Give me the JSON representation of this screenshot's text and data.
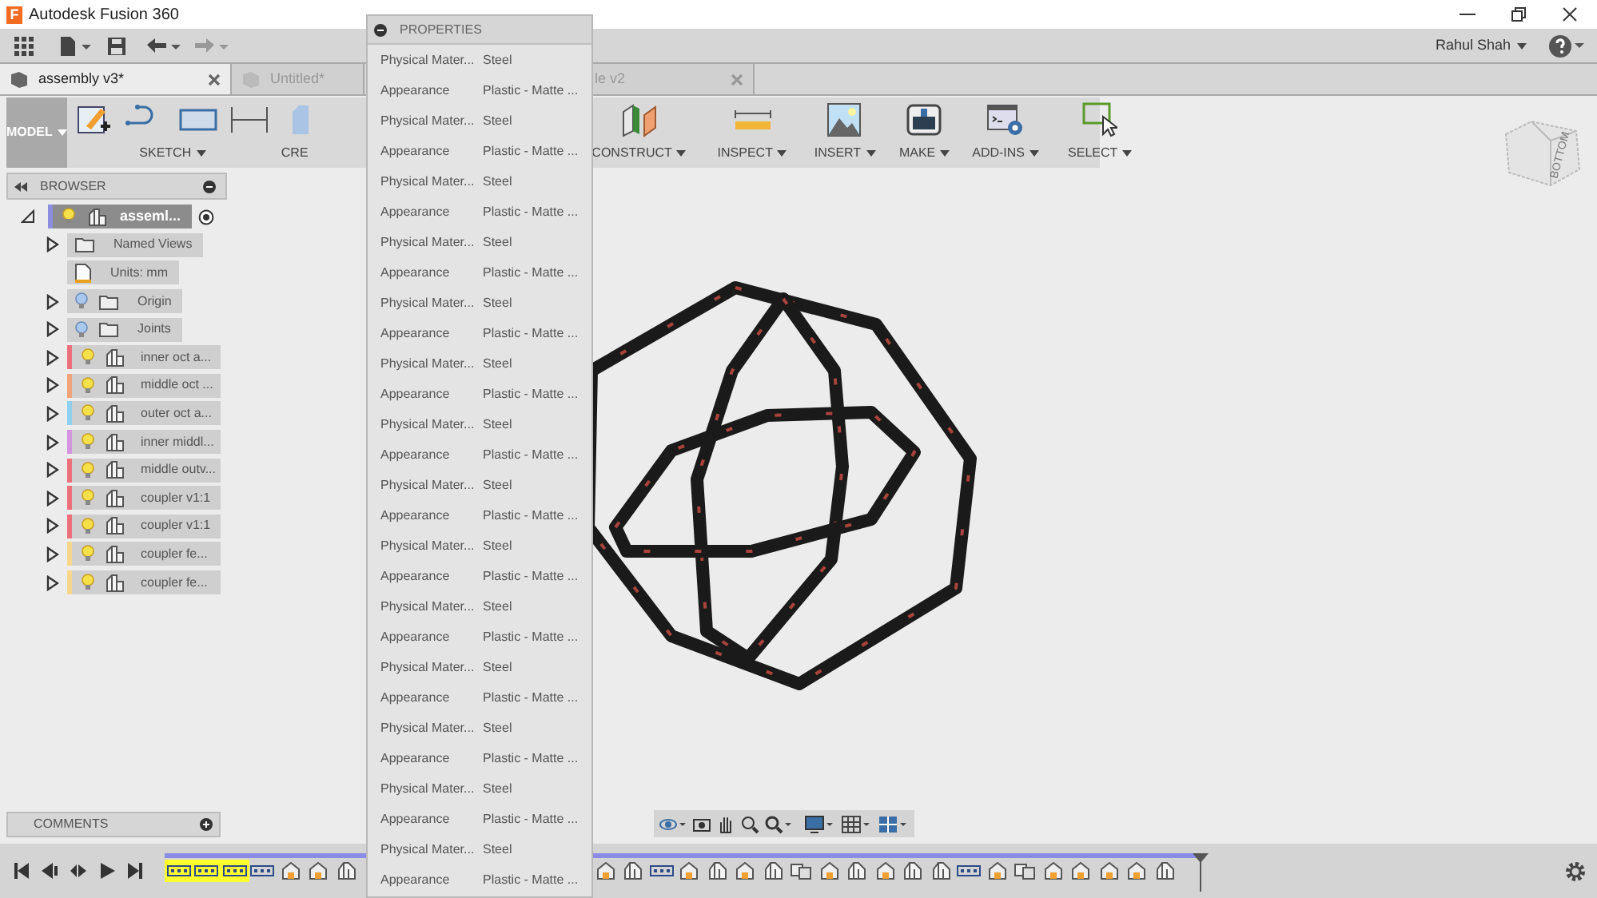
{
  "window": {
    "logo": "F",
    "title": "Autodesk Fusion 360"
  },
  "user": {
    "name": "Rahul Shah"
  },
  "tabs": [
    {
      "label": "assembly v3*",
      "selected": true
    },
    {
      "label": "Untitled*",
      "selected": false
    },
    {
      "label": "le v2",
      "selected": false
    }
  ],
  "toolbar": {
    "workspace": "MODEL",
    "groups": [
      {
        "label": "SKETCH",
        "kind": "sketch"
      },
      {
        "label": "CRE",
        "kind": "create"
      },
      {
        "label": "CONSTRUCT",
        "kind": "construct"
      },
      {
        "label": "INSPECT",
        "kind": "inspect"
      },
      {
        "label": "INSERT",
        "kind": "insert"
      },
      {
        "label": "MAKE",
        "kind": "make"
      },
      {
        "label": "ADD-INS",
        "kind": "addins"
      },
      {
        "label": "SELECT",
        "kind": "select"
      }
    ]
  },
  "view_cube": {
    "label": "BOTTOM"
  },
  "browser": {
    "title": "BROWSER",
    "root": {
      "label": "asseml...",
      "selected": true,
      "expanded": true,
      "color": "#8c8ce0",
      "light_on": true,
      "children": [
        {
          "label": "Named Views",
          "kind": "folder",
          "selected": false,
          "expanded": false
        },
        {
          "label": "Units: mm",
          "kind": "units",
          "selected": false
        },
        {
          "label": "Origin",
          "kind": "folder",
          "selected": false,
          "expanded": false,
          "light_on": false
        },
        {
          "label": "Joints",
          "kind": "folder",
          "selected": false,
          "expanded": false,
          "light_on": false
        },
        {
          "label": "inner oct a...",
          "kind": "component",
          "selected": false,
          "expanded": false,
          "light_on": true,
          "color": "#ee6f7c"
        },
        {
          "label": "middle oct ...",
          "kind": "component",
          "selected": false,
          "expanded": false,
          "light_on": true,
          "color": "#f0a378"
        },
        {
          "label": "outer oct a...",
          "kind": "component",
          "selected": false,
          "expanded": false,
          "light_on": true,
          "color": "#8fd0f0"
        },
        {
          "label": "inner middl...",
          "kind": "component",
          "selected": false,
          "expanded": false,
          "light_on": true,
          "color": "#d594e0"
        },
        {
          "label": "middle outv...",
          "kind": "component",
          "selected": false,
          "expanded": false,
          "light_on": true,
          "color": "#ee6f7c"
        },
        {
          "label": "coupler v1:1",
          "kind": "component",
          "selected": false,
          "expanded": false,
          "light_on": true,
          "color": "#ee6f7c"
        },
        {
          "label": "coupler v1:1",
          "kind": "component",
          "selected": false,
          "expanded": false,
          "light_on": true,
          "color": "#ee6f7c"
        },
        {
          "label": "coupler fe...",
          "kind": "component",
          "selected": false,
          "expanded": false,
          "light_on": true,
          "color": "#f8d68c"
        },
        {
          "label": "coupler fe...",
          "kind": "component",
          "selected": false,
          "expanded": false,
          "light_on": true,
          "color": "#f8d68c"
        }
      ]
    }
  },
  "comments": {
    "title": "COMMENTS"
  },
  "properties": {
    "title": "PROPERTIES",
    "rows": [
      {
        "name": "Physical Mater...",
        "value": "Steel"
      },
      {
        "name": "Appearance",
        "value": "Plastic - Matte ..."
      },
      {
        "name": "Physical Mater...",
        "value": "Steel"
      },
      {
        "name": "Appearance",
        "value": "Plastic - Matte ..."
      },
      {
        "name": "Physical Mater...",
        "value": "Steel"
      },
      {
        "name": "Appearance",
        "value": "Plastic - Matte ..."
      },
      {
        "name": "Physical Mater...",
        "value": "Steel"
      },
      {
        "name": "Appearance",
        "value": "Plastic - Matte ..."
      },
      {
        "name": "Physical Mater...",
        "value": "Steel"
      },
      {
        "name": "Appearance",
        "value": "Plastic - Matte ..."
      },
      {
        "name": "Physical Mater...",
        "value": "Steel"
      },
      {
        "name": "Appearance",
        "value": "Plastic - Matte ..."
      },
      {
        "name": "Physical Mater...",
        "value": "Steel"
      },
      {
        "name": "Appearance",
        "value": "Plastic - Matte ..."
      },
      {
        "name": "Physical Mater...",
        "value": "Steel"
      },
      {
        "name": "Appearance",
        "value": "Plastic - Matte ..."
      },
      {
        "name": "Physical Mater...",
        "value": "Steel"
      },
      {
        "name": "Appearance",
        "value": "Plastic - Matte ..."
      },
      {
        "name": "Physical Mater...",
        "value": "Steel"
      },
      {
        "name": "Appearance",
        "value": "Plastic - Matte ..."
      },
      {
        "name": "Physical Mater...",
        "value": "Steel"
      },
      {
        "name": "Appearance",
        "value": "Plastic - Matte ..."
      },
      {
        "name": "Physical Mater...",
        "value": "Steel"
      },
      {
        "name": "Appearance",
        "value": "Plastic - Matte ..."
      },
      {
        "name": "Physical Mater...",
        "value": "Steel"
      },
      {
        "name": "Appearance",
        "value": "Plastic - Matte ..."
      },
      {
        "name": "Physical Mater...",
        "value": "Steel"
      },
      {
        "name": "Appearance",
        "value": "Plastic - Matte ..."
      }
    ]
  },
  "timeline": {
    "left": [
      {
        "kind": "joint",
        "selected": true
      },
      {
        "kind": "joint",
        "selected": true
      },
      {
        "kind": "joint",
        "selected": true
      },
      {
        "kind": "joint",
        "selected": false
      },
      {
        "kind": "feature",
        "selected": false
      },
      {
        "kind": "feature",
        "selected": false
      },
      {
        "kind": "component",
        "selected": false
      }
    ],
    "right": [
      {
        "kind": "feature",
        "selected": false
      },
      {
        "kind": "component",
        "selected": false
      },
      {
        "kind": "joint",
        "selected": false
      },
      {
        "kind": "feature",
        "selected": false
      },
      {
        "kind": "component",
        "selected": false
      },
      {
        "kind": "feature",
        "selected": false
      },
      {
        "kind": "component",
        "selected": false
      },
      {
        "kind": "rigid",
        "selected": false
      },
      {
        "kind": "feature",
        "selected": false
      },
      {
        "kind": "component",
        "selected": false
      },
      {
        "kind": "feature",
        "selected": false
      },
      {
        "kind": "component",
        "selected": false
      },
      {
        "kind": "component",
        "selected": false
      },
      {
        "kind": "joint",
        "selected": false
      },
      {
        "kind": "feature",
        "selected": false
      },
      {
        "kind": "rigid",
        "selected": false
      },
      {
        "kind": "feature",
        "selected": false
      },
      {
        "kind": "feature",
        "selected": false
      },
      {
        "kind": "feature",
        "selected": false
      },
      {
        "kind": "feature",
        "selected": false
      },
      {
        "kind": "component",
        "selected": false
      }
    ]
  }
}
